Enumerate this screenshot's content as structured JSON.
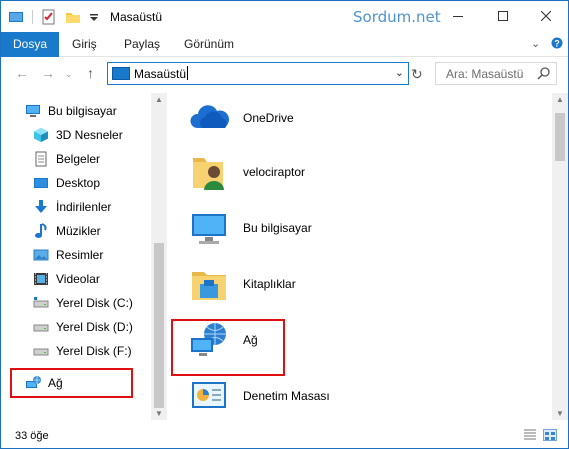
{
  "window": {
    "title": "Masaüstü",
    "watermark": "Sordum.net"
  },
  "ribbon": {
    "tabs": [
      "Dosya",
      "Giriş",
      "Paylaş",
      "Görünüm"
    ],
    "active_tab": "Dosya"
  },
  "address": {
    "path": "Masaüstü",
    "search_placeholder": "Ara: Masaüstü"
  },
  "nav_pane": {
    "items": [
      {
        "label": "Bu bilgisayar",
        "icon": "pc-icon"
      },
      {
        "label": "3D Nesneler",
        "icon": "cube-icon"
      },
      {
        "label": "Belgeler",
        "icon": "document-icon"
      },
      {
        "label": "Desktop",
        "icon": "desktop-icon"
      },
      {
        "label": "İndirilenler",
        "icon": "download-icon"
      },
      {
        "label": "Müzikler",
        "icon": "music-icon"
      },
      {
        "label": "Resimler",
        "icon": "pictures-icon"
      },
      {
        "label": "Videolar",
        "icon": "video-icon"
      },
      {
        "label": "Yerel Disk (C:)",
        "icon": "drive-icon"
      },
      {
        "label": "Yerel Disk (D:)",
        "icon": "drive-icon"
      },
      {
        "label": "Yerel Disk (F:)",
        "icon": "drive-icon"
      },
      {
        "label": "Ağ",
        "icon": "network-icon"
      }
    ]
  },
  "content": {
    "items": [
      {
        "label": "OneDrive",
        "icon": "cloud-icon"
      },
      {
        "label": "velociraptor",
        "icon": "user-folder-icon"
      },
      {
        "label": "Bu bilgisayar",
        "icon": "pc-icon"
      },
      {
        "label": "Kitaplıklar",
        "icon": "libraries-icon"
      },
      {
        "label": "Ağ",
        "icon": "network-icon"
      },
      {
        "label": "Denetim Masası",
        "icon": "control-panel-icon"
      }
    ]
  },
  "status": {
    "item_count": "33 öğe"
  },
  "colors": {
    "accent": "#1979ca",
    "highlight": "#e01010",
    "watermark": "#4f93ce"
  }
}
